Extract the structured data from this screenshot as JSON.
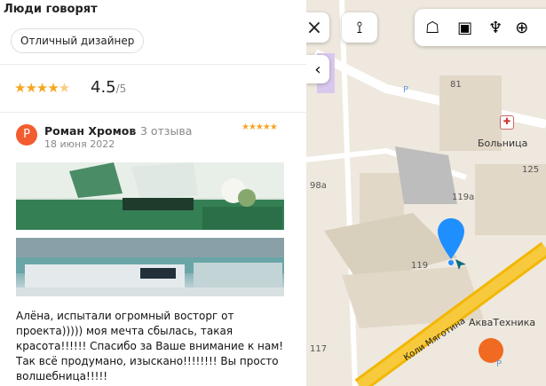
{
  "header": {
    "title": "Люди говорят"
  },
  "tag_chip": "Отличный дизайнер",
  "rating": {
    "value": "4.5",
    "of": "/5"
  },
  "review": {
    "avatar_letter": "Р",
    "author": "Роман Хромов",
    "count": "3 отзыва",
    "date": "18 июня 2022",
    "stars": "★★★★★",
    "text": "Алёна, испытали огромный восторг от проекта))))) моя мечта сбылась, такая красота!!!!!! Спасибо за Ваше внимание к нам! Так всё продумано, изыскано!!!!!!!! Вы просто волшебница!!!!!"
  },
  "map": {
    "labels": {
      "b81": "81",
      "hospital": "Больница",
      "b125": "125",
      "b98a": "98а",
      "b119a": "119а",
      "b119": "119",
      "b117": "117",
      "akva": "АкваТехника",
      "road": "Коли Мяготина",
      "p1": "P",
      "p2": "P"
    },
    "controls": {
      "close": "×",
      "collapse": "‹"
    }
  },
  "colors": {
    "accent": "#f5a623",
    "avatar": "#f25c2f",
    "pin": "#1f8fff",
    "road": "#f2b705"
  }
}
